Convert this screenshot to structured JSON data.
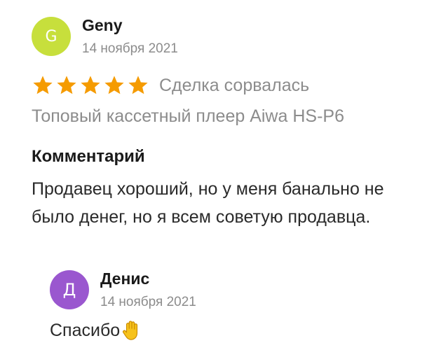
{
  "review": {
    "author": {
      "initial": "G",
      "name": "Geny",
      "date": "14 ноября 2021",
      "avatar_color": "#c7df3c"
    },
    "rating": 5,
    "max_rating": 5,
    "star_color": "#f59b00",
    "deal_status": "Сделка сорвалась",
    "item_title": "Топовый кассетный плеер Aiwa HS-P6",
    "comment_heading": "Комментарий",
    "comment_text": "Продавец хороший, но у меня банально не было денег, но я всем советую продавца."
  },
  "reply": {
    "author": {
      "initial": "Д",
      "name": "Денис",
      "date": "14 ноября 2021",
      "avatar_color": "#9a57cf"
    },
    "text": "Спасибо",
    "emoji_icon": "raised-hand-icon"
  }
}
